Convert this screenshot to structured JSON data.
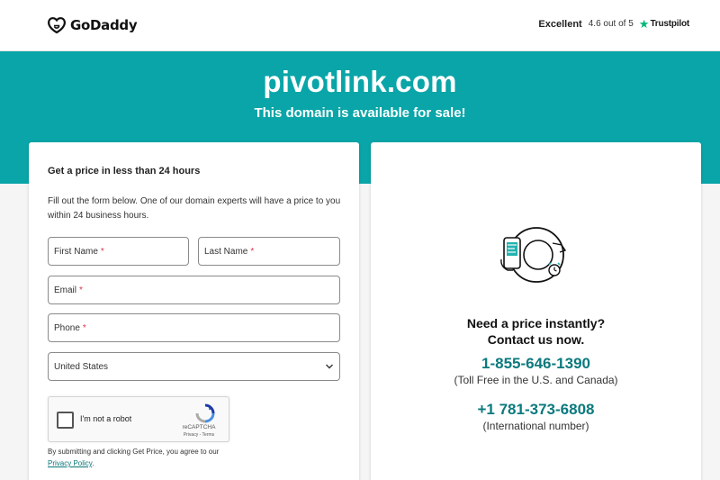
{
  "header": {
    "brand": "GoDaddy",
    "trustpilot": {
      "rating_word": "Excellent",
      "score": "4.6 out of 5",
      "brand": "Trustpilot"
    }
  },
  "hero": {
    "domain": "pivotlink.com",
    "subtitle": "This domain is available for sale!",
    "color": "#09a5a8"
  },
  "form": {
    "title": "Get a price in less than 24 hours",
    "description": "Fill out the form below. One of our domain experts will have a price to you within 24 business hours.",
    "fields": {
      "first_name": "First Name",
      "last_name": "Last Name",
      "email": "Email",
      "phone": "Phone",
      "country": "United States"
    },
    "required_mark": "*",
    "captcha": {
      "label": "I'm not a robot",
      "brand": "reCAPTCHA",
      "terms": "Privacy - Terms"
    },
    "legal_text": "By submitting and clicking Get Price, you agree to our",
    "privacy_link": "Privacy Policy",
    "legal_end": "."
  },
  "contact": {
    "heading_line1": "Need a price instantly?",
    "heading_line2": "Contact us now.",
    "phone_us": "1-855-646-1390",
    "phone_us_note": "(Toll Free in the U.S. and Canada)",
    "phone_intl": "+1 781-373-6808",
    "phone_intl_note": "(International number)",
    "accent_color": "#0b7a7e"
  }
}
